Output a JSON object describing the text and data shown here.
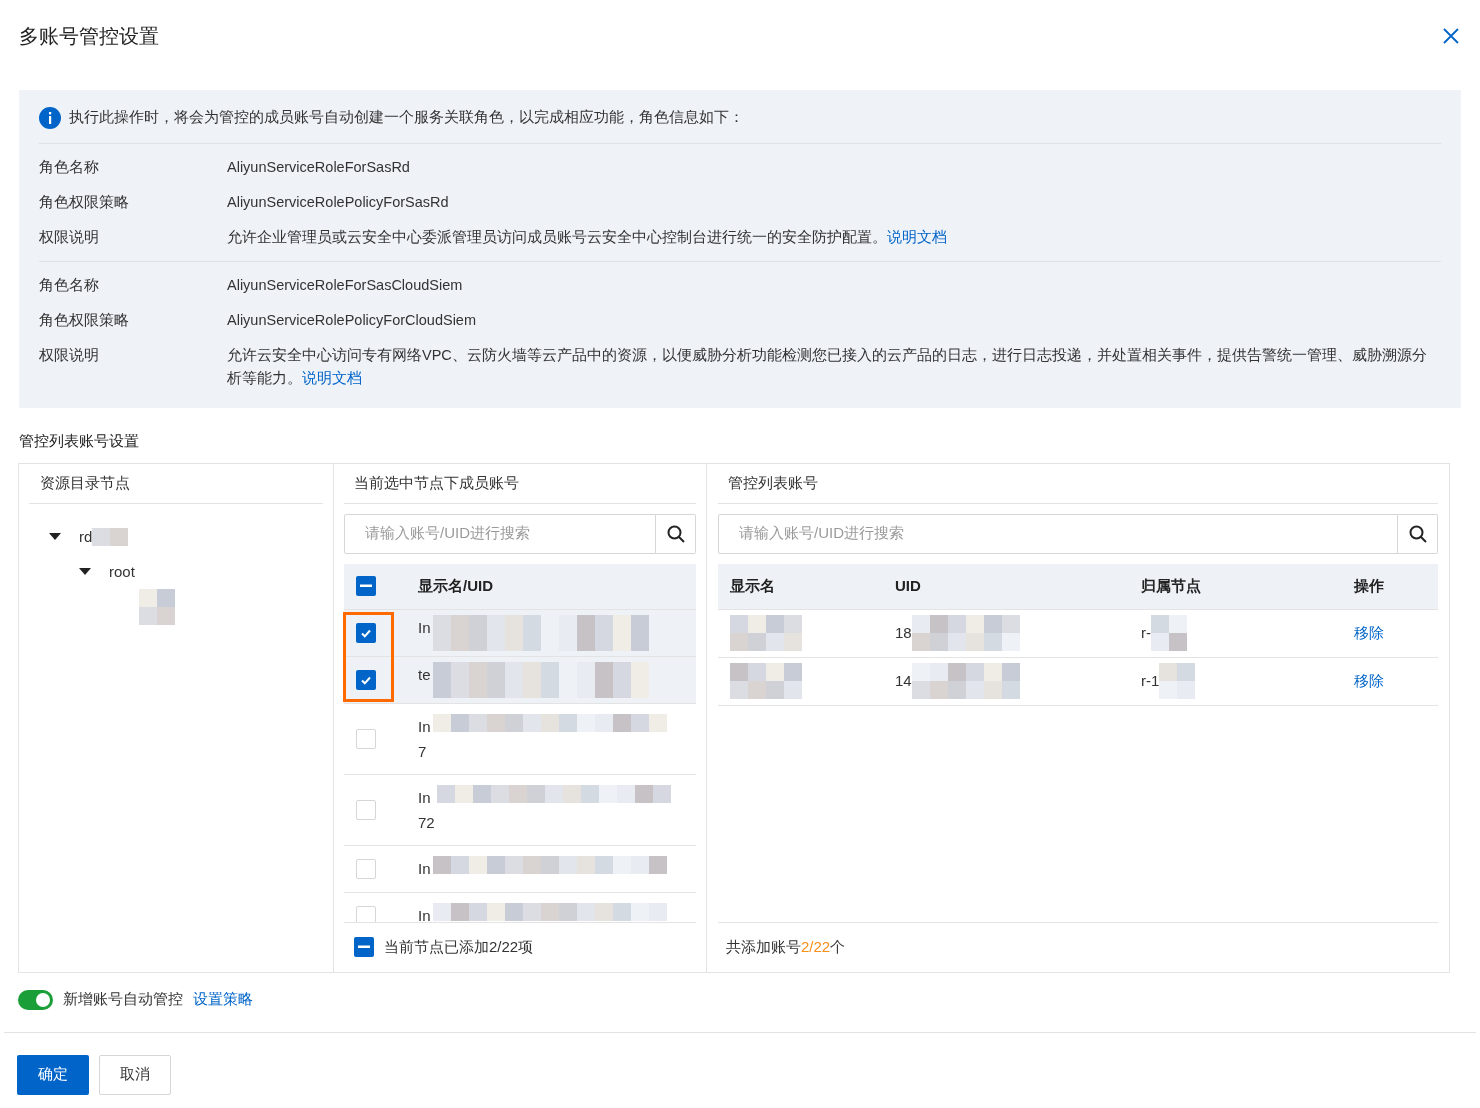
{
  "dialog": {
    "title": "多账号管控设置"
  },
  "notice": {
    "message": "执行此操作时，将会为管控的成员账号自动创建一个服务关联角色，以完成相应功能，角色信息如下：",
    "roles": [
      {
        "fields": [
          {
            "label": "角色名称",
            "value": "AliyunServiceRoleForSasRd"
          },
          {
            "label": "角色权限策略",
            "value": "AliyunServiceRolePolicyForSasRd"
          },
          {
            "label": "权限说明",
            "value": "允许企业管理员或云安全中心委派管理员访问成员账号云安全中心控制台进行统一的安全防护配置。",
            "link": "说明文档"
          }
        ]
      },
      {
        "fields": [
          {
            "label": "角色名称",
            "value": "AliyunServiceRoleForSasCloudSiem"
          },
          {
            "label": "角色权限策略",
            "value": "AliyunServiceRolePolicyForCloudSiem"
          },
          {
            "label": "权限说明",
            "value": "允许云安全中心访问专有网络VPC、云防火墙等云产品中的资源，以便威胁分析功能检测您已接入的云产品的日志，进行日志投递，并处置相关事件，提供告警统一管理、威胁溯源分析等能力。",
            "link": "说明文档"
          }
        ]
      }
    ]
  },
  "section_title": "管控列表账号设置",
  "tree_panel": {
    "title": "资源目录节点",
    "nodes": [
      {
        "label": "rd",
        "redacted": true,
        "expanded": true,
        "children": [
          {
            "label": "root",
            "redacted": false,
            "expanded": true,
            "children": [
              {
                "redacted": true
              }
            ]
          }
        ]
      }
    ]
  },
  "member_panel": {
    "title": "当前选中节点下成员账号",
    "search": {
      "placeholder": "请输入账号/UID进行搜索"
    },
    "select_all_indeterminate": true,
    "column": "显示名/UID",
    "rows": [
      {
        "lines": [
          "In"
        ],
        "checked": true
      },
      {
        "lines": [
          "te"
        ],
        "checked": true
      },
      {
        "lines": [
          "In",
          "7"
        ],
        "checked": false
      },
      {
        "lines": [
          "In",
          "72"
        ],
        "checked": false
      },
      {
        "lines": [
          "In"
        ],
        "checked": false
      },
      {
        "lines": [
          "In"
        ],
        "checked": false
      }
    ],
    "footer": {
      "indeterminate": true,
      "text": "当前节点已添加2/22项"
    }
  },
  "managed_panel": {
    "title": "管控列表账号",
    "search": {
      "placeholder": "请输入账号/UID进行搜索"
    },
    "columns": [
      "显示名",
      "UID",
      "归属节点",
      "操作"
    ],
    "rows": [
      {
        "uid": "18",
        "node": "r-",
        "action": "移除"
      },
      {
        "uid": "14",
        "node": "r-1",
        "action": "移除"
      }
    ],
    "footer": {
      "prefix": "共添加账号",
      "count": "2/22",
      "suffix": "个"
    }
  },
  "auto_manage": {
    "on": true,
    "label": "新增账号自动管控",
    "link": "设置策略"
  },
  "buttons": [
    {
      "label": "确定",
      "kind": "primary"
    },
    {
      "label": "取消",
      "kind": "secondary"
    }
  ]
}
